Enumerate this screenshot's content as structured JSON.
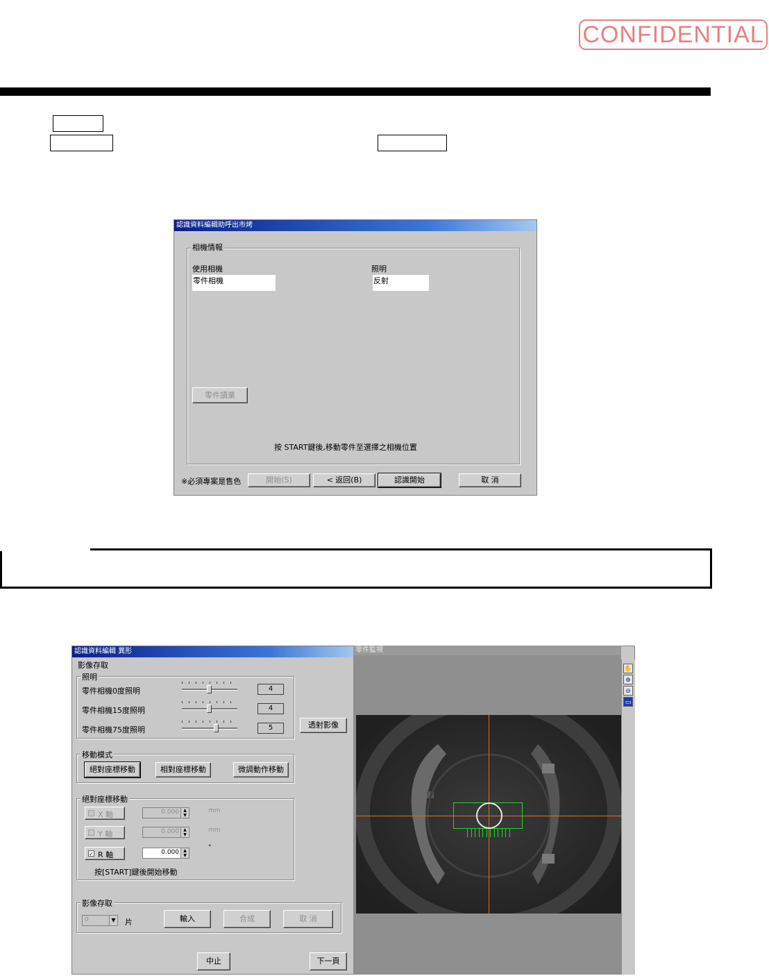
{
  "stamp": "CONFIDENTIAL",
  "dialog1": {
    "title": "認識資料編輯助呼出市烤",
    "group_title": "相機情報",
    "camera_label": "使用相機",
    "camera_value": "零件相機",
    "light_label": "照明",
    "light_value": "反射",
    "part_button": "零件讀業",
    "hint": "按 START鍵後,移動零件至選擇之相機位置",
    "footnote": "※必須專案是售色",
    "btn_open": "開始(S)",
    "btn_back": "< 返回(B)",
    "btn_start": "認識開始",
    "btn_cancel": "取 消"
  },
  "app": {
    "title": "認識資料編輯  異形",
    "section_label": "影像存取",
    "lighting_group": "照明",
    "lights": [
      {
        "label": "零件相機0度照明",
        "value": "4",
        "level": 0.5
      },
      {
        "label": "零件相機15度照明",
        "value": "4",
        "level": 0.5
      },
      {
        "label": "零件相機75度照明",
        "value": "5",
        "level": 0.62
      }
    ],
    "transmit_button": "透射影像",
    "move_group": "移動模式",
    "move_buttons": [
      "絕對座標移動",
      "相對座標移動",
      "微調動作移動"
    ],
    "abs_group": "絕對座標移動",
    "axes": [
      {
        "label": "X 軸",
        "value": "0.000",
        "unit": "mm",
        "checked": false
      },
      {
        "label": "Y 軸",
        "value": "0.000",
        "unit": "mm",
        "checked": false
      },
      {
        "label": "R 軸",
        "value": "0.000",
        "unit": "°",
        "checked": true
      }
    ],
    "start_hint": "按[START]鍵後開始移動",
    "capture_group": "影像存取",
    "capture_count": "0",
    "capture_unit": "片",
    "capture_buttons": [
      "輸入",
      "合成",
      "取 消"
    ],
    "btn_stop": "中止",
    "btn_next": "下一頁"
  },
  "monitor": {
    "title": "零件監視",
    "tools": [
      "hand-icon",
      "zoom-in-icon",
      "zoom-out-icon",
      "fit-window-icon"
    ]
  },
  "colors": {
    "stamp": "#e88080",
    "crosshair": "#e06a1e",
    "overlay": "#22d822"
  }
}
